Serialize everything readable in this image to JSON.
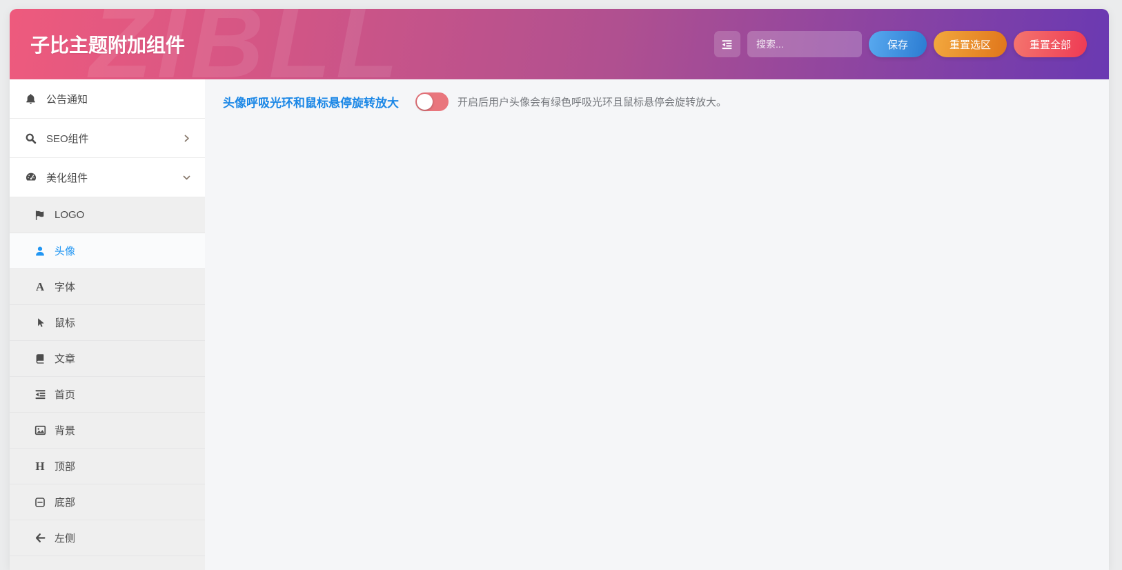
{
  "app": {
    "title": "子比主题附加组件",
    "watermark": "ZIBLL"
  },
  "header": {
    "menu_icon": "outdent-icon",
    "search_placeholder": "搜索...",
    "buttons": {
      "save": "保存",
      "reset_section": "重置选区",
      "reset_all": "重置全部"
    }
  },
  "sidebar": {
    "items": [
      {
        "label": "公告通知",
        "icon": "bell-icon"
      },
      {
        "label": "SEO组件",
        "icon": "search-icon",
        "state": "collapsed"
      },
      {
        "label": "美化组件",
        "icon": "tachometer-icon",
        "state": "expanded"
      }
    ],
    "subitems": [
      {
        "label": "LOGO",
        "icon": "flag-icon"
      },
      {
        "label": "头像",
        "icon": "user-icon",
        "active": true
      },
      {
        "label": "字体",
        "icon": "font-icon",
        "glyph": "A"
      },
      {
        "label": "鼠标",
        "icon": "mouse-pointer-icon"
      },
      {
        "label": "文章",
        "icon": "book-icon"
      },
      {
        "label": "首页",
        "icon": "indent-icon"
      },
      {
        "label": "背景",
        "icon": "image-icon"
      },
      {
        "label": "顶部",
        "icon": "heading-icon",
        "glyph": "H"
      },
      {
        "label": "底部",
        "icon": "minus-square-icon"
      },
      {
        "label": "左侧",
        "icon": "arrow-left-icon"
      }
    ]
  },
  "main": {
    "setting": {
      "label": "头像呼吸光环和鼠标悬停旋转放大",
      "enabled": false,
      "description": "开启后用户头像会有绿色呼吸光环且鼠标悬停会旋转放大。"
    }
  },
  "colors": {
    "header_gradient_start": "#ee5a7d",
    "header_gradient_end": "#6a39b2",
    "setting_label_blue": "#1b87e6",
    "active_item_blue": "#2196f3",
    "toggle_off": "#e9767d",
    "save_button_blue": "#2d7ed2",
    "reset_section_orange": "#e8851f",
    "reset_all_red": "#ef4156",
    "content_background": "#f5f6f8"
  }
}
